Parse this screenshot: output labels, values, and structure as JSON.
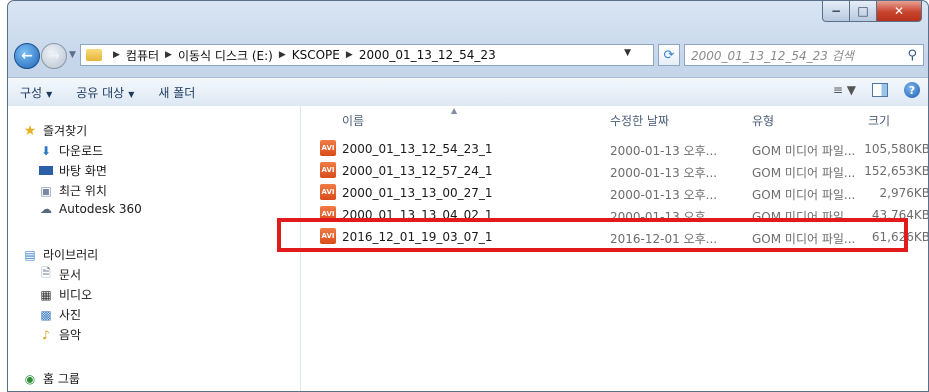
{
  "window": {
    "caption": {
      "minimize": "−",
      "maximize": "□",
      "close": "✕"
    }
  },
  "address": {
    "breadcrumbs": [
      "컴퓨터",
      "이동식 디스크 (E:)",
      "KSCOPE",
      "2000_01_13_12_54_23"
    ],
    "search_placeholder": "2000_01_13_12_54_23 검색"
  },
  "toolbar": {
    "organize": "구성",
    "share": "공유 대상",
    "new_folder": "새 폴더"
  },
  "sidebar": {
    "favorites_title": "즐겨찾기",
    "favorites": [
      "다운로드",
      "바탕 화면",
      "최근 위치",
      "Autodesk 360"
    ],
    "libraries_title": "라이브러리",
    "libraries": [
      "문서",
      "비디오",
      "사진",
      "음악"
    ],
    "homegroup": "홈 그룹"
  },
  "columns": {
    "name": "이름",
    "modified": "수정한 날짜",
    "type": "유형",
    "size": "크기"
  },
  "files": [
    {
      "icon": "avi-file-icon",
      "name": "2000_01_13_12_54_23_1",
      "modified": "2000-01-13 오후...",
      "type": "GOM 미디어 파일...",
      "size": "105,580KB"
    },
    {
      "icon": "avi-file-icon",
      "name": "2000_01_13_12_57_24_1",
      "modified": "2000-01-13 오후...",
      "type": "GOM 미디어 파일...",
      "size": "152,653KB"
    },
    {
      "icon": "avi-file-icon",
      "name": "2000_01_13_13_00_27_1",
      "modified": "2000-01-13 오후...",
      "type": "GOM 미디어 파일...",
      "size": "2,976KB"
    },
    {
      "icon": "avi-file-icon",
      "name": "2000_01_13_13_04_02_1",
      "modified": "2000-01-13 오후...",
      "type": "GOM 미디어 파일...",
      "size": "43,764KB"
    },
    {
      "icon": "avi-file-icon",
      "name": "2016_12_01_19_03_07_1",
      "modified": "2016-12-01 오후...",
      "type": "GOM 미디어 파일...",
      "size": "61,626KB"
    }
  ],
  "colors": {
    "highlight_border": "#e11b1b",
    "accent": "#1f64b8"
  }
}
